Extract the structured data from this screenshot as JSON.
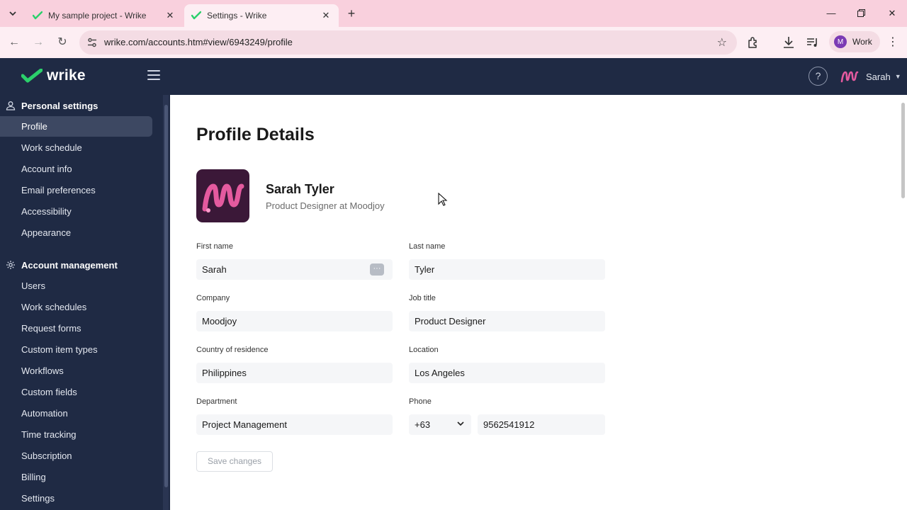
{
  "browser": {
    "tabs": [
      {
        "title": "My sample project - Wrike",
        "active": false
      },
      {
        "title": "Settings - Wrike",
        "active": true
      }
    ],
    "url": "wrike.com/accounts.htm#view/6943249/profile",
    "profile_label": "Work",
    "profile_initial": "M"
  },
  "app": {
    "logo_text": "wrike",
    "user_name": "Sarah"
  },
  "sidebar": {
    "personal": {
      "title": "Personal settings",
      "items": [
        "Profile",
        "Work schedule",
        "Account info",
        "Email preferences",
        "Accessibility",
        "Appearance"
      ]
    },
    "account": {
      "title": "Account management",
      "items": [
        "Users",
        "Work schedules",
        "Request forms",
        "Custom item types",
        "Workflows",
        "Custom fields",
        "Automation",
        "Time tracking",
        "Subscription",
        "Billing",
        "Settings"
      ]
    },
    "active_item": "Profile"
  },
  "profile": {
    "page_title": "Profile Details",
    "full_name": "Sarah Tyler",
    "subtitle": "Product Designer at Moodjoy",
    "fields": {
      "first_name": {
        "label": "First name",
        "value": "Sarah"
      },
      "last_name": {
        "label": "Last name",
        "value": "Tyler"
      },
      "company": {
        "label": "Company",
        "value": "Moodjoy"
      },
      "job_title": {
        "label": "Job title",
        "value": "Product Designer"
      },
      "country": {
        "label": "Country of residence",
        "value": "Philippines"
      },
      "location": {
        "label": "Location",
        "value": "Los Angeles"
      },
      "department": {
        "label": "Department",
        "value": "Project Management"
      },
      "phone": {
        "label": "Phone",
        "country_code": "+63",
        "number": "9562541912"
      }
    },
    "save_label": "Save changes"
  },
  "colors": {
    "tabstrip": "#f9d0dd",
    "appbar": "#1f2a44",
    "brand_green": "#2bd06b",
    "avatar_pink": "#e45a9f"
  }
}
